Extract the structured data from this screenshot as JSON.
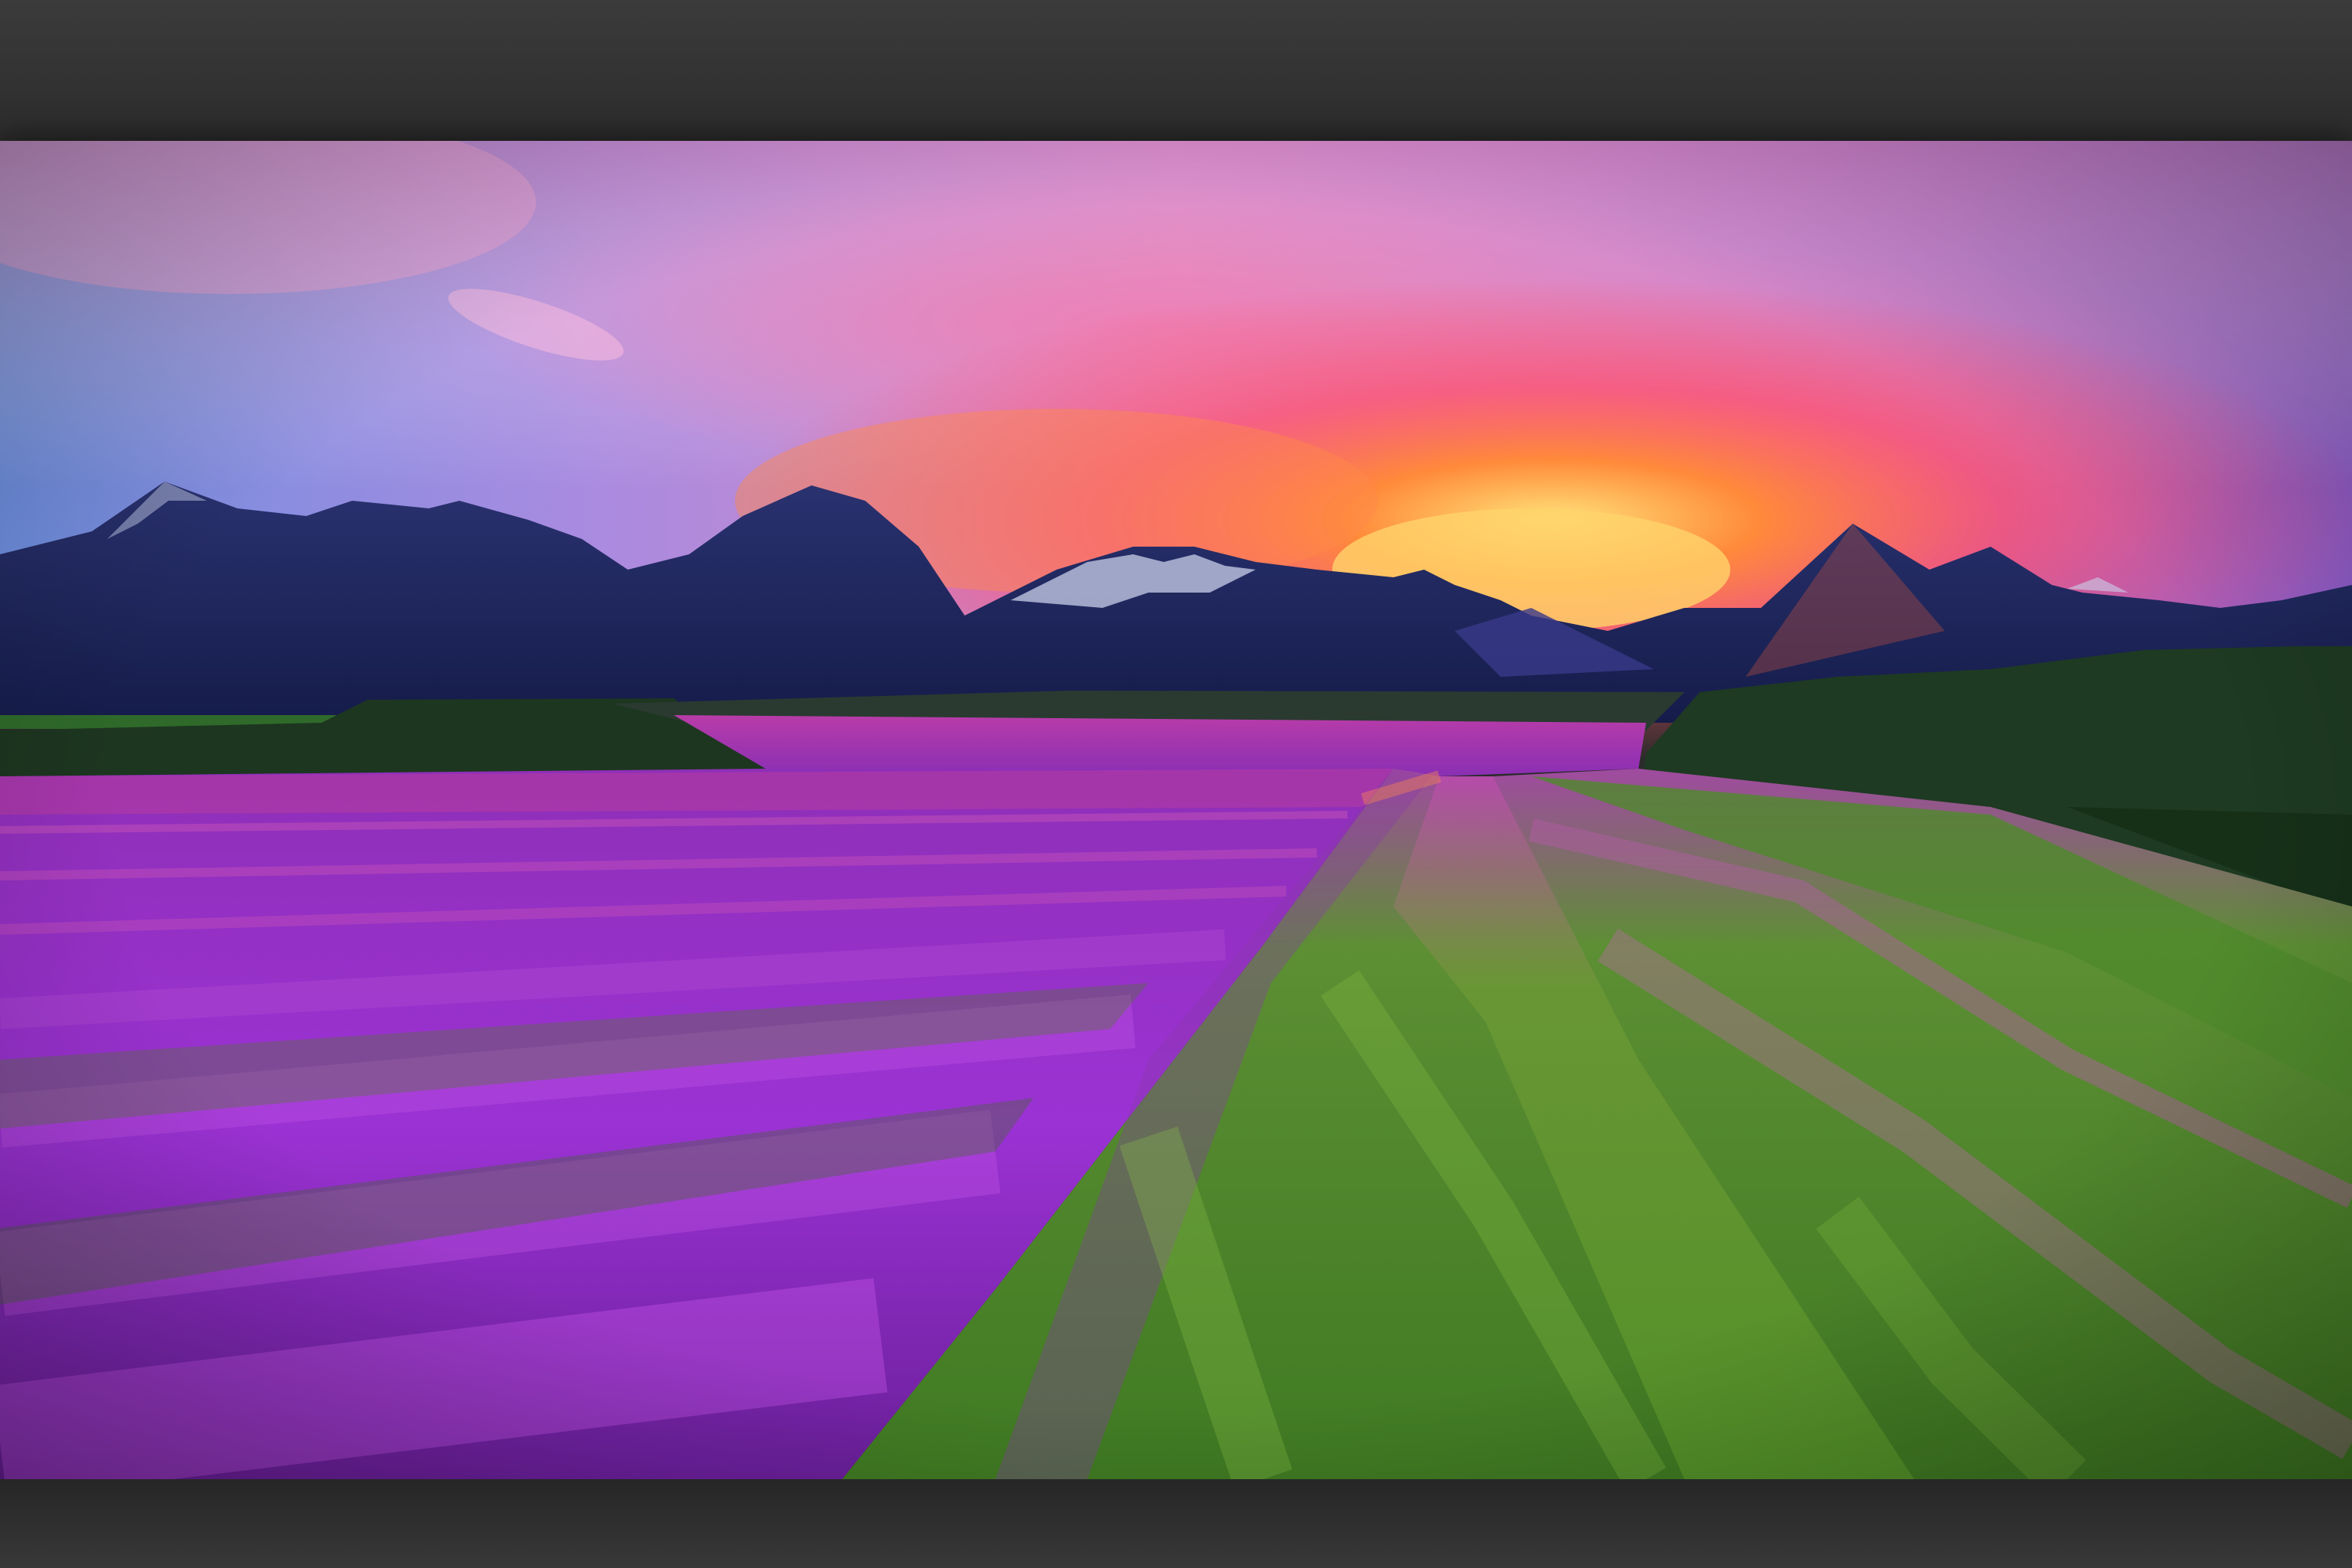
{
  "scene": {
    "subject": "",
    "colors": {
      "frame": "#2e2e2e",
      "sky_top": "#c47bc9",
      "sky_left": "#6f8fd8",
      "sunset_core": "#ffcc55",
      "sunset_glow": "#ff5a3c",
      "cloud_pink": "#e56fa8",
      "mountains": "#1f2a63",
      "mountains_far": "#3c3f8f",
      "snow": "#c9d0ea",
      "trees": "#1e3a22",
      "lavender": "#9b2fd0",
      "lavender_bright": "#c44be8",
      "grass": "#5c9a2c",
      "grass_light": "#86b83c"
    }
  }
}
